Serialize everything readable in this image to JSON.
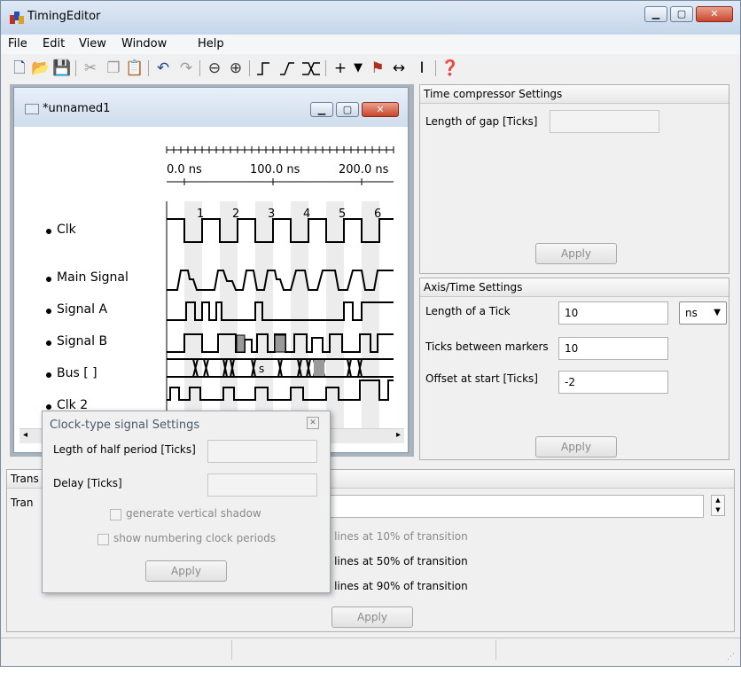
{
  "window": {
    "title": "TimingEditor"
  },
  "menu": [
    "File",
    "Edit",
    "View",
    "Window",
    "Help"
  ],
  "child": {
    "title": "*unnamed1",
    "ruler": {
      "labels": [
        "0.0 ns",
        "100.0 ns",
        "200.0 ns"
      ]
    },
    "clock_numbers": [
      "1",
      "2",
      "3",
      "4",
      "5",
      "6"
    ],
    "signals": [
      "Clk",
      "Main Signal",
      "Signal A",
      "Signal B",
      "Bus [ ]",
      "Clk 2"
    ],
    "bus_value": "s"
  },
  "time_compressor": {
    "header": "Time compressor Settings",
    "gap_label": "Length of gap [Ticks]",
    "gap_value": "",
    "apply": "Apply"
  },
  "axis": {
    "header": "Axis/Time Settings",
    "tick_label": "Length of a Tick",
    "tick_value": "10",
    "unit": "ns",
    "markers_label": "Ticks between markers",
    "markers_value": "10",
    "offset_label": "Offset at start [Ticks]",
    "offset_value": "-2",
    "apply": "Apply"
  },
  "transition": {
    "header": "Trans",
    "row_label": "Tran",
    "value": "",
    "opt10": "cal lines at 10% of transition",
    "opt50": "cal lines at 50% of transition",
    "opt90": "cal lines at 90% of transition",
    "apply": "Apply"
  },
  "clock_popup": {
    "title": "Clock-type signal Settings",
    "half_label": "Legth of half period [Ticks]",
    "half_value": "",
    "delay_label": "Delay [Ticks]",
    "delay_value": "",
    "shadow_label": "generate vertical shadow",
    "numbering_label": "show numbering clock periods",
    "apply": "Apply"
  },
  "icons": {
    "toolbar": [
      "new-icon",
      "open-icon",
      "save-icon",
      "cut-icon",
      "copy-icon",
      "paste-icon",
      "undo-icon",
      "redo-icon",
      "zoom-out-icon",
      "zoom-in-icon",
      "rising-edge-icon",
      "slope-icon",
      "bus-transition-icon",
      "add-marker-icon",
      "dropdown-arrow-icon",
      "signal-marker-icon",
      "horizontal-arrow-icon",
      "text-cursor-icon",
      "help-icon"
    ]
  }
}
